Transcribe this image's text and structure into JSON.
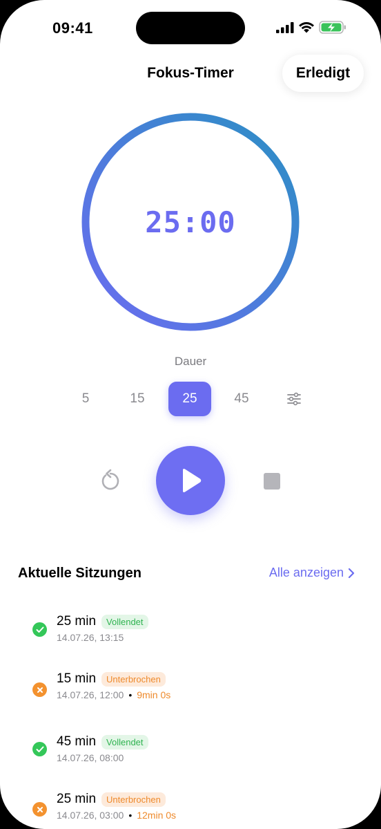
{
  "status_bar": {
    "time": "09:41"
  },
  "nav": {
    "title": "Fokus-Timer",
    "done_label": "Erledigt"
  },
  "timer": {
    "display": "25:00"
  },
  "duration": {
    "label": "Dauer",
    "options": [
      "5",
      "15",
      "25",
      "45"
    ],
    "selected": "25"
  },
  "colors": {
    "accent": "#6b6cf0",
    "ring_start": "#2b8fc4",
    "ring_end": "#6b6cf0",
    "success": "#34c759",
    "warning": "#f3922f"
  },
  "icons": {
    "reset": "reset-icon",
    "play": "play-icon",
    "stop": "stop-icon",
    "settings": "sliders-icon"
  },
  "sessions": {
    "title": "Aktuelle Sitzungen",
    "see_all": "Alle anzeigen",
    "items": [
      {
        "duration": "25 min",
        "status": "Vollendet",
        "kind": "ok",
        "date": "14.07.26, 13:15",
        "elapsed": ""
      },
      {
        "duration": "15 min",
        "status": "Unterbrochen",
        "kind": "warn",
        "date": "14.07.26, 12:00",
        "elapsed": "9min 0s"
      },
      {
        "duration": "45 min",
        "status": "Vollendet",
        "kind": "ok",
        "date": "14.07.26, 08:00",
        "elapsed": ""
      },
      {
        "duration": "25 min",
        "status": "Unterbrochen",
        "kind": "warn",
        "date": "14.07.26, 03:00",
        "elapsed": "12min 0s"
      }
    ]
  }
}
